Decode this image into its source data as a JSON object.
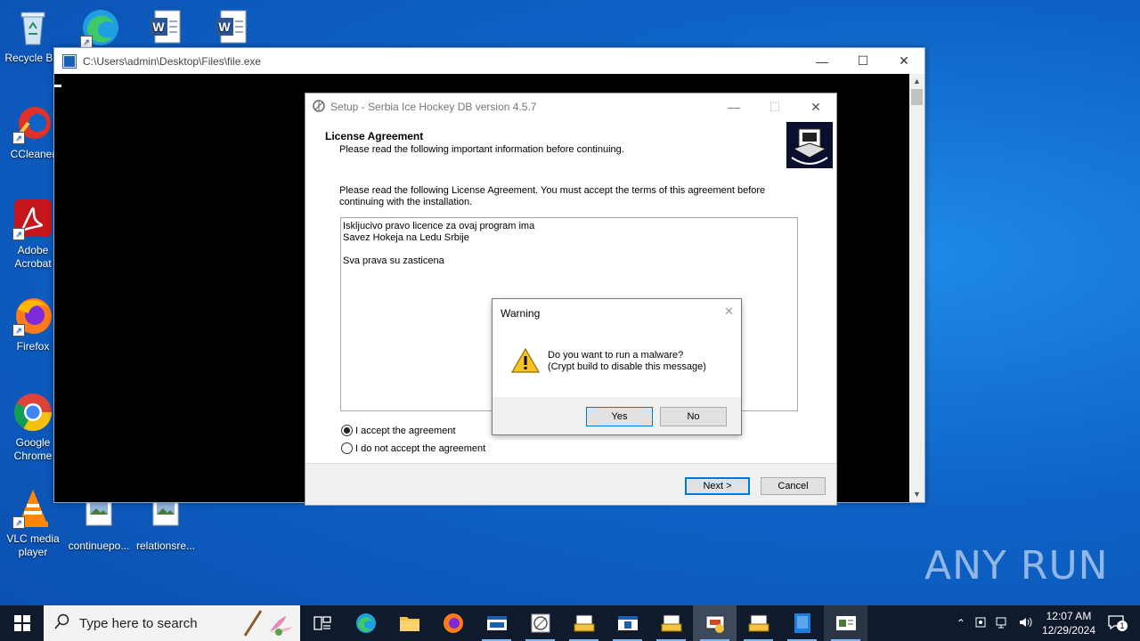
{
  "desktop": {
    "icons": [
      {
        "label": "Recycle Bin",
        "icon": "recycle-bin-icon"
      },
      {
        "label": "CCleaner",
        "icon": "ccleaner-icon"
      },
      {
        "label": "Adobe Acrobat",
        "icon": "adobe-acrobat-icon"
      },
      {
        "label": "Firefox",
        "icon": "firefox-icon"
      },
      {
        "label": "Google Chrome",
        "icon": "chrome-icon"
      },
      {
        "label": "VLC media player",
        "icon": "vlc-icon"
      },
      {
        "label": "continuepo...",
        "icon": "image-file-icon"
      },
      {
        "label": "relationsre...",
        "icon": "image-file-icon"
      }
    ]
  },
  "console": {
    "title": "C:\\Users\\admin\\Desktop\\Files\\file.exe"
  },
  "setup": {
    "title": "Setup - Serbia Ice Hockey DB version 4.5.7",
    "section_title": "License Agreement",
    "section_subtitle": "Please read the following important information before continuing.",
    "description": "Please read the following License Agreement. You must accept the terms of this agreement before continuing with the installation.",
    "license_lines": [
      "Iskljucivo pravo licence za ovaj program ima",
      "Savez Hokeja na Ledu Srbije",
      "",
      "Sva prava su zasticena"
    ],
    "accept_label": "I accept the agreement",
    "decline_label": "I do not accept the agreement",
    "accept_selected": true,
    "next_label": "Next >",
    "cancel_label": "Cancel"
  },
  "warning": {
    "title": "Warning",
    "message_line1": "Do you want to run a malware?",
    "message_line2": "(Crypt build to disable this message)",
    "yes_label": "Yes",
    "no_label": "No"
  },
  "taskbar": {
    "search_placeholder": "Type here to search",
    "time": "12:07 AM",
    "date": "12/29/2024",
    "notification_count": "1"
  },
  "watermark": "ANY RUN",
  "colors": {
    "accent": "#0078d7",
    "taskbar": "#0f1b2d",
    "desktop": "#0e63c7"
  }
}
